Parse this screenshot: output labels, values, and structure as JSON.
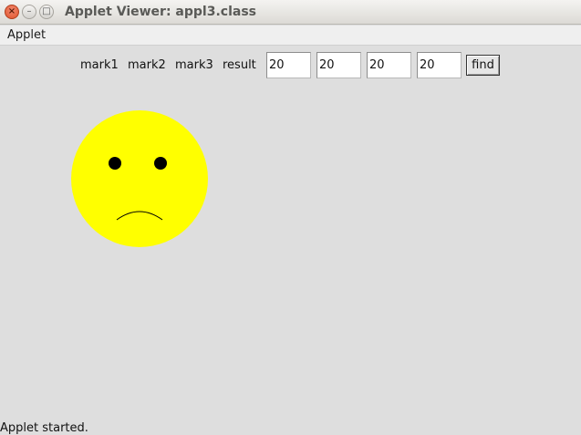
{
  "window": {
    "title": "Applet Viewer: appl3.class",
    "close_glyph": "×",
    "min_glyph": "–",
    "max_glyph": "□"
  },
  "menu": {
    "applet_label": "Applet"
  },
  "form": {
    "labels": [
      "mark1",
      "mark2",
      "mark3",
      "result"
    ],
    "values": [
      "20",
      "20",
      "20",
      "20"
    ],
    "find_label": "find"
  },
  "face": {
    "expression": "sad",
    "fill_color": "#ffff00",
    "eye_color": "#000000"
  },
  "status": {
    "text": "Applet started."
  }
}
